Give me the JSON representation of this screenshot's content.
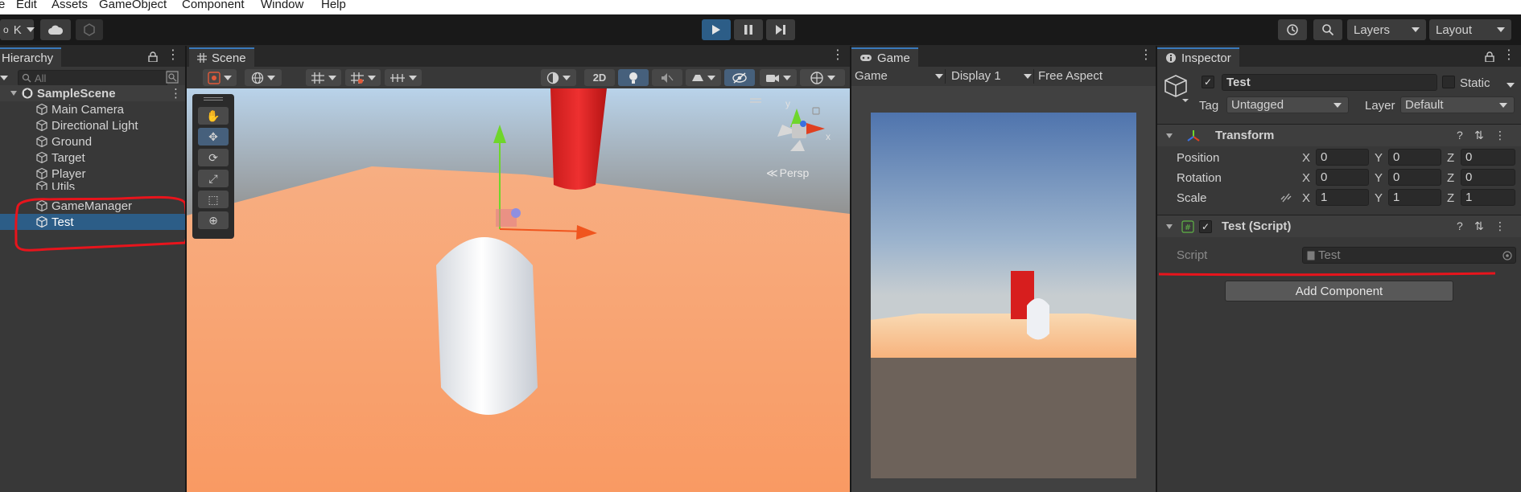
{
  "menu": [
    "e",
    "Edit",
    "Assets",
    "GameObject",
    "Component",
    "Window",
    "Help"
  ],
  "toolbar": {
    "account_initial": "K",
    "history_icon": "history-icon",
    "search_icon": "search-icon",
    "layers_label": "Layers",
    "layout_label": "Layout"
  },
  "hierarchy": {
    "tab_label": "Hierarchy",
    "search_placeholder": "All",
    "scene_name": "SampleScene",
    "items": [
      {
        "label": "Main Camera",
        "selected": false
      },
      {
        "label": "Directional Light",
        "selected": false
      },
      {
        "label": "Ground",
        "selected": false
      },
      {
        "label": "Target",
        "selected": false
      },
      {
        "label": "Player",
        "selected": false
      },
      {
        "label": "Utils",
        "selected": false
      },
      {
        "label": "GameManager",
        "selected": false
      },
      {
        "label": "Test",
        "selected": true
      }
    ]
  },
  "scene": {
    "tab_label": "Scene",
    "mode_2d_label": "2D",
    "persp_label": "Persp",
    "gizmo_x": "x",
    "gizmo_y": "y"
  },
  "game": {
    "tab_label": "Game",
    "view_select": "Game",
    "display_select": "Display 1",
    "aspect_select": "Free Aspect"
  },
  "inspector": {
    "tab_label": "Inspector",
    "object_name": "Test",
    "active": true,
    "static_label": "Static",
    "tag_label": "Tag",
    "tag_value": "Untagged",
    "layer_label": "Layer",
    "layer_value": "Default",
    "transform": {
      "title": "Transform",
      "rows": [
        {
          "label": "Position",
          "x": "0",
          "y": "0",
          "z": "0"
        },
        {
          "label": "Rotation",
          "x": "0",
          "y": "0",
          "z": "0"
        },
        {
          "label": "Scale",
          "x": "1",
          "y": "1",
          "z": "1"
        }
      ]
    },
    "script_component": {
      "title": "Test (Script)",
      "enabled": true,
      "field_label": "Script",
      "field_value": "Test"
    },
    "add_component_label": "Add Component",
    "axis_x": "X",
    "axis_y": "Y",
    "axis_z": "Z"
  },
  "colors": {
    "accent": "#2c5d87",
    "annotation": "#e8141c",
    "panel": "#383838",
    "ground": "#f99f6b",
    "cylinder": "#e02424"
  }
}
